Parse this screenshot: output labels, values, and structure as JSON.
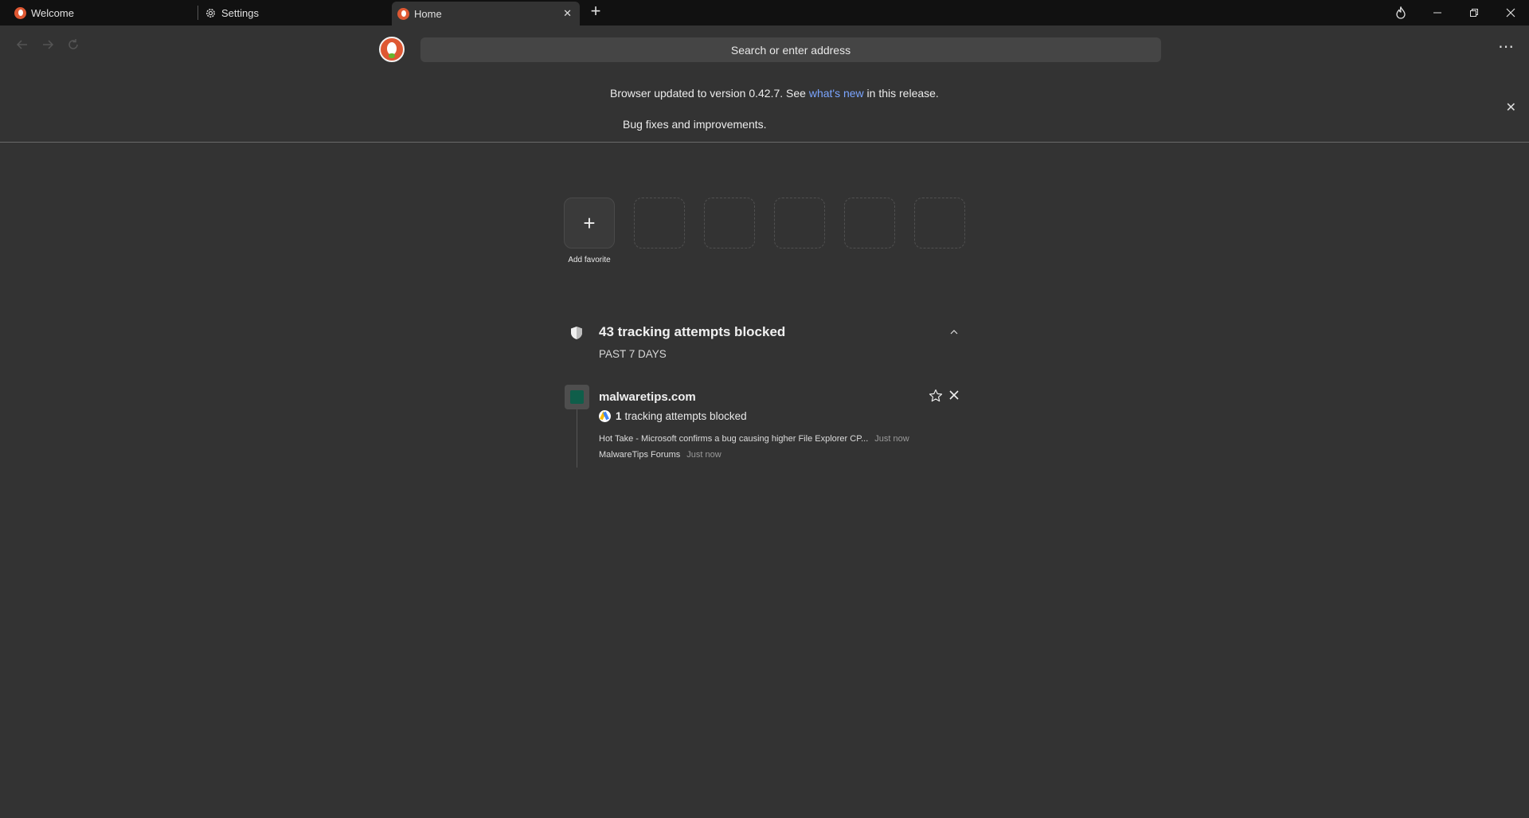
{
  "tabs": [
    {
      "label": "Welcome"
    },
    {
      "label": "Settings"
    },
    {
      "label": "Home",
      "close": "✕"
    }
  ],
  "tabstrip": {
    "new_tab": "+"
  },
  "address_bar": {
    "placeholder": "Search or enter address"
  },
  "banner": {
    "prefix": "Browser updated to version 0.42.7.  See ",
    "link": "what's new",
    "suffix": " in this release.",
    "details": "Bug fixes and improvements."
  },
  "favorites": {
    "add_label": "Add favorite",
    "empty_slots": 5
  },
  "protection": {
    "title": "43 tracking attempts blocked",
    "period": "PAST 7 DAYS",
    "sites": [
      {
        "domain": "malwaretips.com",
        "tracker_count": "1",
        "tracker_text": "tracking attempts blocked",
        "history": [
          {
            "title": "Hot Take - Microsoft confirms a bug causing higher File Explorer CP...",
            "time": "Just now"
          },
          {
            "title": "MalwareTips Forums",
            "time": "Just now"
          }
        ]
      }
    ]
  },
  "colors": {
    "background": "#333333",
    "tabstrip": "#111111",
    "link": "#7ba5ff",
    "brand": "#de5833"
  }
}
